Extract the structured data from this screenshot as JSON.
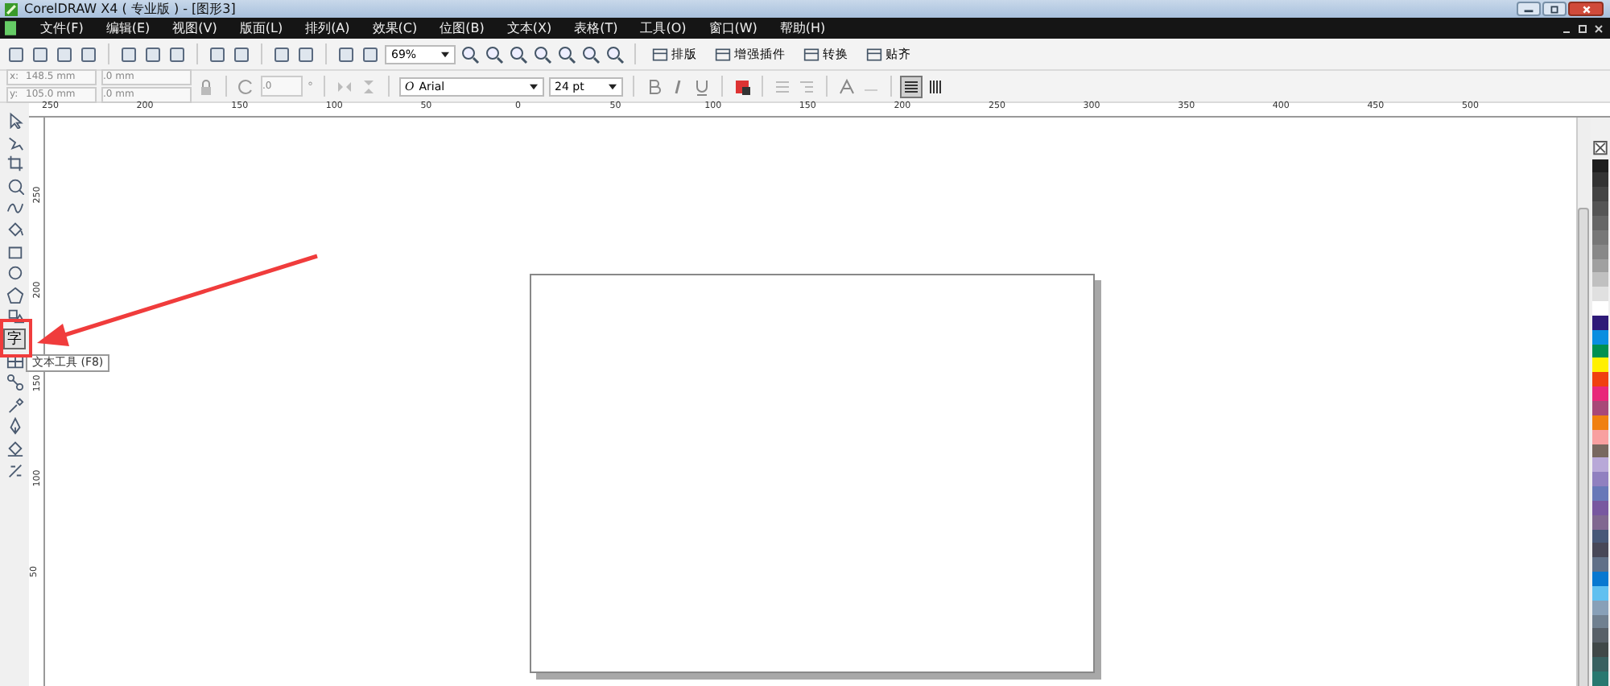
{
  "window": {
    "title": "CorelDRAW X4 ( 专业版 ) - [图形3]"
  },
  "menu": [
    "文件(F)",
    "编辑(E)",
    "视图(V)",
    "版面(L)",
    "排列(A)",
    "效果(C)",
    "位图(B)",
    "文本(X)",
    "表格(T)",
    "工具(O)",
    "窗口(W)",
    "帮助(H)"
  ],
  "toolbar": {
    "zoom": "69%",
    "buttons": [
      "排版",
      "增强插件",
      "转换",
      "贴齐"
    ]
  },
  "property_bar": {
    "x_label": "x:",
    "x": "148.5 mm",
    "y_label": "y:",
    "y": "105.0 mm",
    "width": ".0 mm",
    "height": ".0 mm",
    "rotation": ".0",
    "degree": "°",
    "font_icon": "O",
    "font": "Arial",
    "font_size": "24 pt"
  },
  "rulers": {
    "horizontal": [
      "250",
      "200",
      "150",
      "100",
      "50",
      "0",
      "50",
      "100",
      "150",
      "200",
      "250",
      "300",
      "350",
      "400",
      "450",
      "500"
    ],
    "vertical": [
      "250",
      "200",
      "150",
      "100",
      "50"
    ]
  },
  "tools": [
    {
      "kind": "pointer",
      "selected": false
    },
    {
      "kind": "shape",
      "selected": false
    },
    {
      "kind": "crop",
      "selected": false
    },
    {
      "kind": "zoom",
      "selected": false
    },
    {
      "kind": "freehand",
      "selected": false
    },
    {
      "kind": "smart-fill",
      "selected": false
    },
    {
      "kind": "rectangle",
      "selected": false
    },
    {
      "kind": "ellipse",
      "selected": false
    },
    {
      "kind": "polygon",
      "selected": false
    },
    {
      "kind": "basic-shapes",
      "selected": false
    },
    {
      "kind": "text",
      "label": "字",
      "selected": true
    },
    {
      "kind": "table",
      "selected": false
    },
    {
      "kind": "blend",
      "selected": false
    },
    {
      "kind": "eyedropper",
      "selected": false
    },
    {
      "kind": "outline",
      "selected": false
    },
    {
      "kind": "fill",
      "selected": false
    },
    {
      "kind": "interactive-fill",
      "selected": false
    }
  ],
  "tooltip": "文本工具 (F8)",
  "palette": [
    {
      "color": "#1e1e1e"
    },
    {
      "color": "#333333"
    },
    {
      "color": "#444444"
    },
    {
      "color": "#555555"
    },
    {
      "color": "#666666"
    },
    {
      "color": "#777777"
    },
    {
      "color": "#888888"
    },
    {
      "color": "#a0a0a0"
    },
    {
      "color": "#c0c0c0"
    },
    {
      "color": "#e0e0e0"
    },
    {
      "color": "#ffffff"
    },
    {
      "color": "#2e1a78"
    },
    {
      "color": "#0a8ee0"
    },
    {
      "color": "#009050"
    },
    {
      "color": "#fff000"
    },
    {
      "color": "#f04010"
    },
    {
      "color": "#e8287a"
    },
    {
      "color": "#a84878"
    },
    {
      "color": "#f08010"
    },
    {
      "color": "#f8a0a0"
    },
    {
      "color": "#786860"
    },
    {
      "color": "#b8a8d8"
    },
    {
      "color": "#9080c0"
    },
    {
      "color": "#6878b8"
    },
    {
      "color": "#7858a0"
    },
    {
      "color": "#806890"
    },
    {
      "color": "#485878"
    },
    {
      "color": "#484858"
    },
    {
      "color": "#607088"
    },
    {
      "color": "#0878d0"
    },
    {
      "color": "#60c0f0"
    },
    {
      "color": "#88a0b8"
    },
    {
      "color": "#708090"
    },
    {
      "color": "#586068"
    },
    {
      "color": "#404848"
    },
    {
      "color": "#386060"
    },
    {
      "color": "#287870"
    }
  ]
}
